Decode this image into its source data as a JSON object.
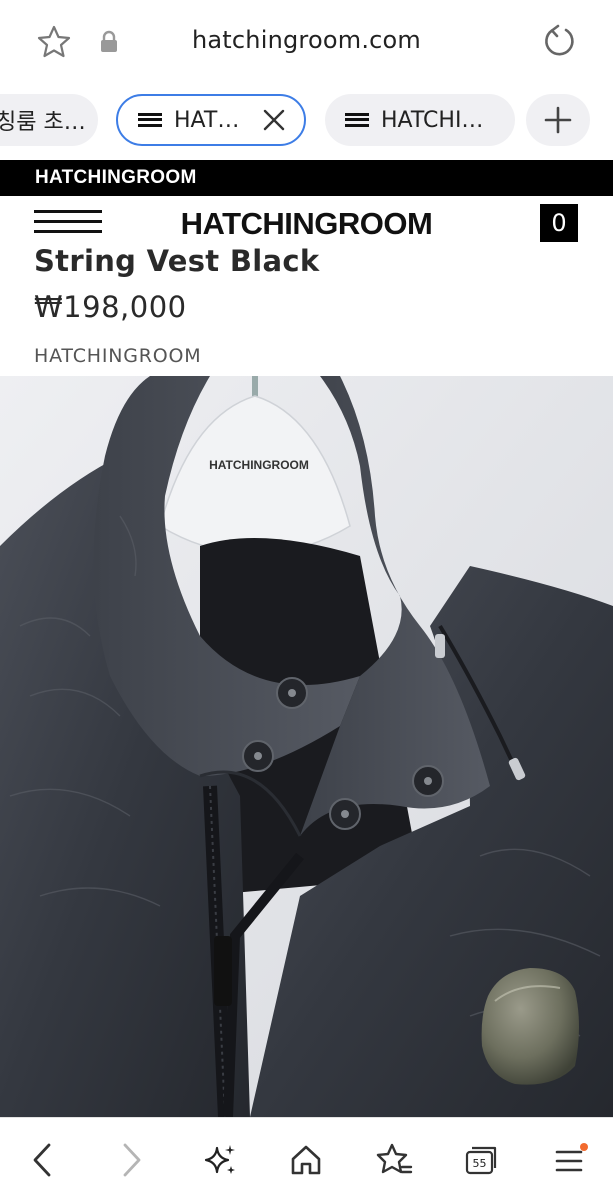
{
  "browser": {
    "url": "hatchingroom.com",
    "tabs": [
      {
        "label": "칭룸 초…",
        "active": false
      },
      {
        "label": "HAT…",
        "active": true
      },
      {
        "label": "HATCHI…",
        "active": false
      }
    ],
    "tab_count": "55"
  },
  "site": {
    "top_bar_text": "HATCHINGROOM",
    "logo": "HATCHINGROOM",
    "cart_count": "0"
  },
  "product": {
    "name": "String Vest Black",
    "price": "₩198,000",
    "brand": "HATCHINGROOM",
    "hanger_text": "HATCHINGROOM"
  },
  "colors": {
    "accent": "#3d7de6",
    "notification_dot": "#f26a2e"
  }
}
